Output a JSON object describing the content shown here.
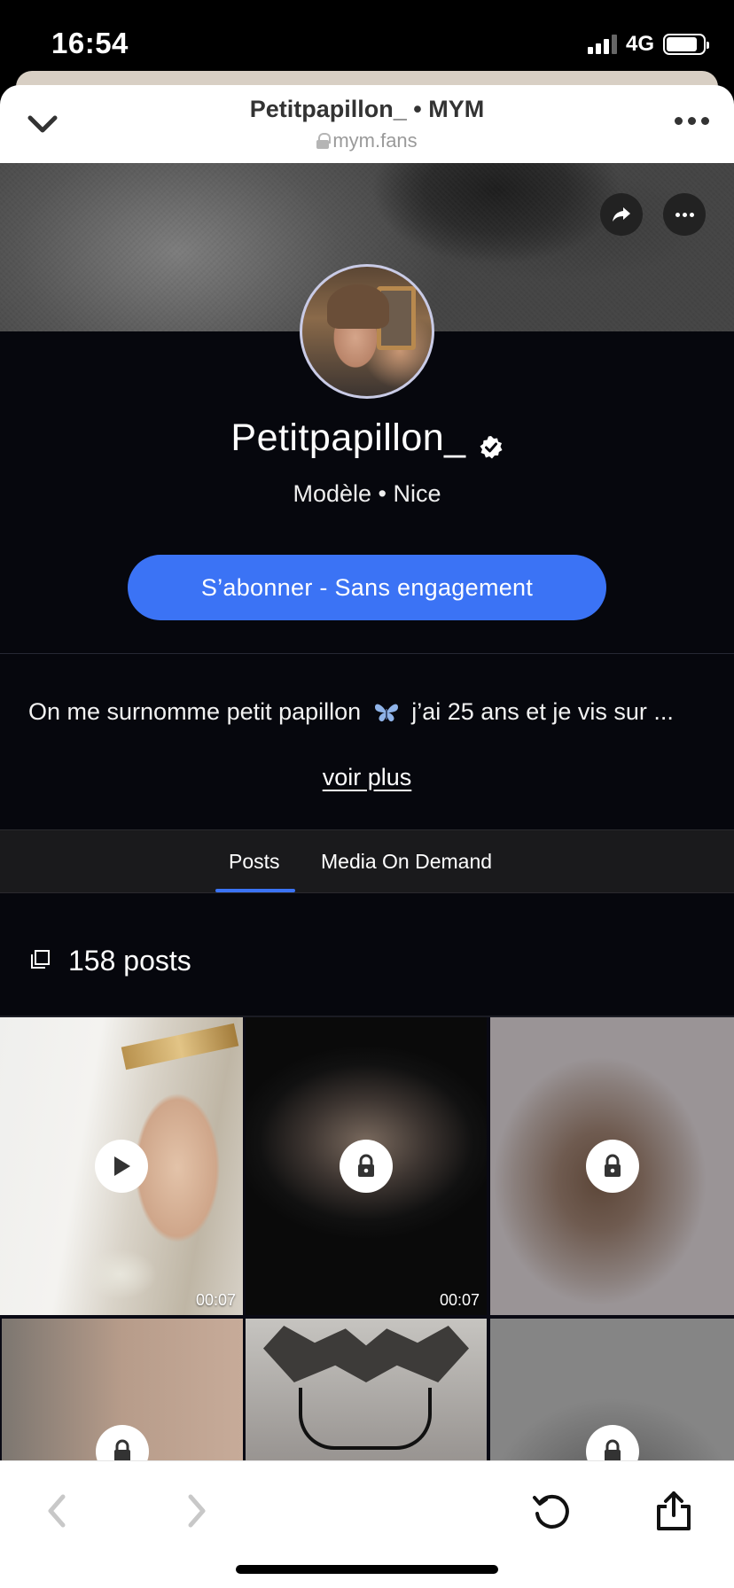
{
  "status_bar": {
    "time": "16:54",
    "network": "4G",
    "battery_level": 0.85
  },
  "browser_header": {
    "title": "Petitpapillon_ • MYM",
    "url": "mym.fans",
    "icons": [
      "chevron-down-icon",
      "lock-icon",
      "more-icon"
    ]
  },
  "cover": {
    "buttons": [
      "share-icon",
      "more-icon"
    ]
  },
  "profile": {
    "name": "Petitpapillon_",
    "verified": true,
    "subtitle": "Modèle • Nice",
    "subscribe_label": "S’abonner - Sans engagement",
    "accent_color": "#3b73f5"
  },
  "bio": {
    "text_before": "On me surnomme petit papillon",
    "text_after": "j’ai 25 ans et je vis sur ...",
    "more_label": "voir plus"
  },
  "tabs": [
    {
      "label": "Posts",
      "active": true
    },
    {
      "label": "Media On Demand",
      "active": false
    }
  ],
  "posts": {
    "count_label": "158 posts"
  },
  "grid": [
    {
      "type": "video",
      "locked": false,
      "duration": "00:07"
    },
    {
      "type": "video",
      "locked": true,
      "duration": "00:07"
    },
    {
      "type": "image",
      "locked": true
    },
    {
      "type": "image",
      "locked": true
    },
    {
      "type": "image",
      "locked": false
    },
    {
      "type": "image",
      "locked": true
    }
  ],
  "toolbar": {
    "icons": [
      "back-icon",
      "forward-icon",
      "reload-icon",
      "share-icon"
    ]
  }
}
